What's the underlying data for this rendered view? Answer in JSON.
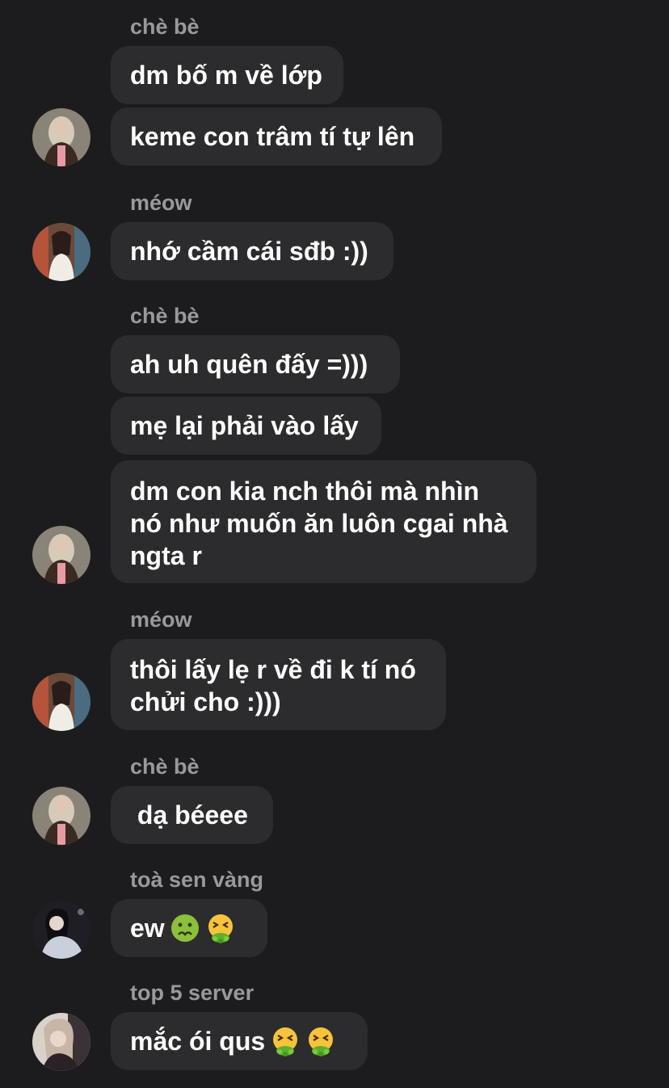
{
  "messages": [
    {
      "sender": "chè bè",
      "lines": [
        "dm bố m về lớp",
        "keme con trâm tí tự lên"
      ]
    },
    {
      "sender": "méow",
      "lines": [
        "nhớ cầm cái sđb :))"
      ]
    },
    {
      "sender": "chè bè",
      "lines": [
        "ah uh quên đấy =)))",
        "mẹ lại phải vào lấy",
        "dm con kia nch thôi mà nhìn\nnó như muốn ăn luôn cgai nhà\nngta r"
      ]
    },
    {
      "sender": "méow",
      "lines": [
        "thôi lấy lẹ r về đi k tí nó\nchửi cho :)))"
      ]
    },
    {
      "sender": "chè bè",
      "lines": [
        " dạ béeee"
      ]
    },
    {
      "sender": "toà sen vàng",
      "lines": [
        "ew"
      ]
    },
    {
      "sender": "top 5 server",
      "lines": [
        "mắc ói qus"
      ]
    }
  ],
  "emojis": {
    "g6": [
      "nauseated-face-icon",
      "vomiting-face-icon"
    ],
    "g7": [
      "vomiting-face-icon",
      "vomiting-face-icon"
    ]
  },
  "colors": {
    "background": "#1c1c1e",
    "bubble": "#2c2c2e",
    "sender_name": "#98989e",
    "text": "#ffffff"
  }
}
